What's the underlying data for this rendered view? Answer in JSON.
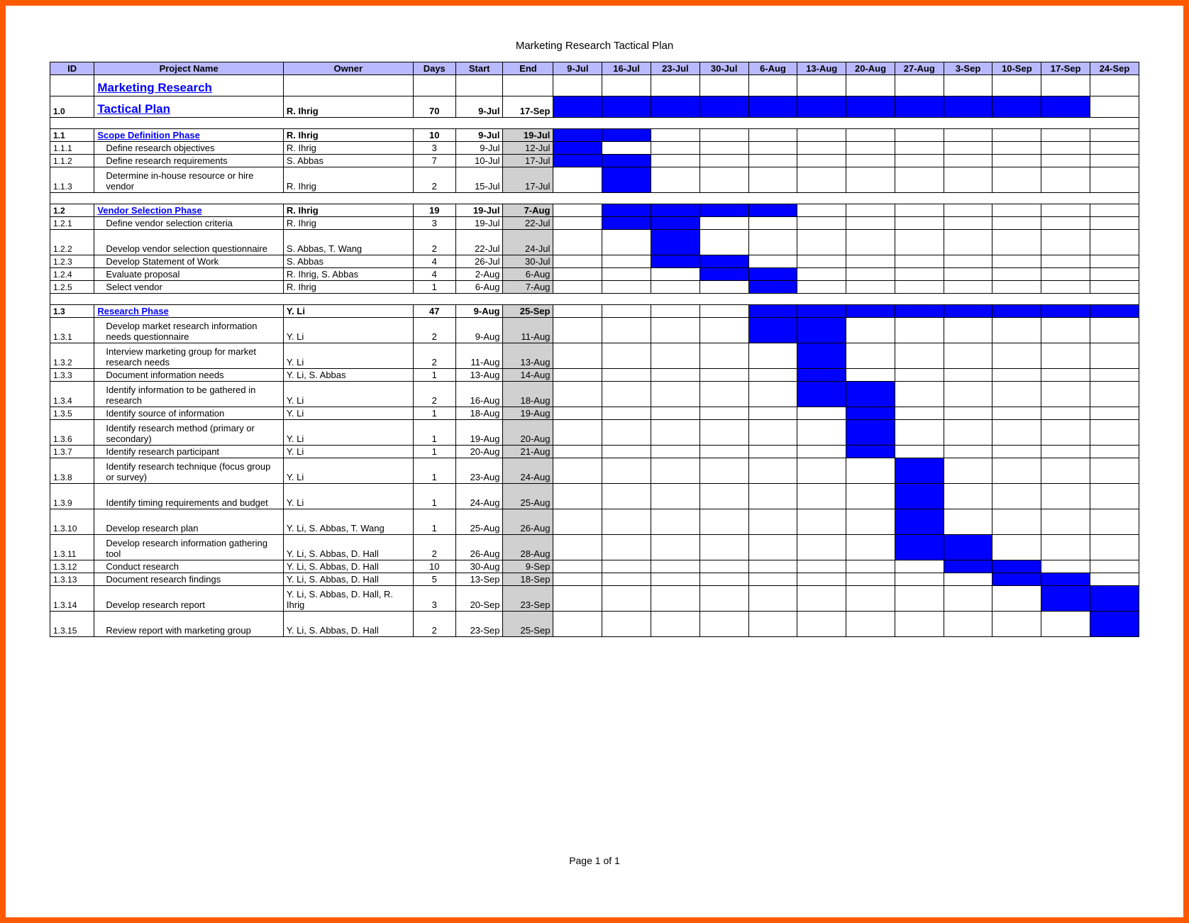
{
  "doc_title": "Marketing Research Tactical Plan",
  "footer": "Page 1 of 1",
  "headers": {
    "id": "ID",
    "name": "Project Name",
    "owner": "Owner",
    "days": "Days",
    "start": "Start",
    "end": "End"
  },
  "weeks": [
    "9-Jul",
    "16-Jul",
    "23-Jul",
    "30-Jul",
    "6-Aug",
    "13-Aug",
    "20-Aug",
    "27-Aug",
    "3-Sep",
    "10-Sep",
    "17-Sep",
    "24-Sep"
  ],
  "rows": [
    {
      "type": "title",
      "id": "",
      "name": "Marketing Research",
      "link": true
    },
    {
      "type": "title",
      "id": "1.0",
      "name": "Tactical Plan",
      "owner": "R. Ihrig",
      "days": "70",
      "start": "9-Jul",
      "end": "17-Sep",
      "link": true,
      "bars": [
        0,
        1,
        2,
        3,
        4,
        5,
        6,
        7,
        8,
        9,
        10
      ],
      "bold": true,
      "shade": false
    },
    {
      "type": "spacer"
    },
    {
      "type": "phase",
      "id": "1.1",
      "name": "Scope Definition Phase",
      "owner": "R. Ihrig",
      "days": "10",
      "start": "9-Jul",
      "end": "19-Jul",
      "link": true,
      "bars": [
        0,
        1
      ],
      "bold": true
    },
    {
      "id": "1.1.1",
      "name": "Define research objectives",
      "owner": "R. Ihrig",
      "days": "3",
      "start": "9-Jul",
      "end": "12-Jul",
      "bars": [
        0
      ],
      "indent": true
    },
    {
      "id": "1.1.2",
      "name": "Define research requirements",
      "owner": "S. Abbas",
      "days": "7",
      "start": "10-Jul",
      "end": "17-Jul",
      "bars": [
        0,
        1
      ],
      "indent": true
    },
    {
      "id": "1.1.3",
      "name": "Determine in-house resource or hire vendor",
      "owner": "R. Ihrig",
      "days": "2",
      "start": "15-Jul",
      "end": "17-Jul",
      "bars": [
        1
      ],
      "indent": true,
      "tall": true
    },
    {
      "type": "spacer"
    },
    {
      "type": "phase",
      "id": "1.2",
      "name": "Vendor Selection Phase",
      "owner": "R. Ihrig",
      "days": "19",
      "start": "19-Jul",
      "end": "7-Aug",
      "link": true,
      "bars": [
        1,
        2,
        3,
        4
      ],
      "bold": true
    },
    {
      "id": "1.2.1",
      "name": "Define vendor selection criteria",
      "owner": "R. Ihrig",
      "days": "3",
      "start": "19-Jul",
      "end": "22-Jul",
      "bars": [
        1,
        2
      ],
      "indent": true
    },
    {
      "id": "1.2.2",
      "name": "Develop vendor selection questionnaire",
      "owner": "S. Abbas, T. Wang",
      "days": "2",
      "start": "22-Jul",
      "end": "24-Jul",
      "bars": [
        2
      ],
      "indent": true,
      "tall": true
    },
    {
      "id": "1.2.3",
      "name": "Develop Statement of Work",
      "owner": "S. Abbas",
      "days": "4",
      "start": "26-Jul",
      "end": "30-Jul",
      "bars": [
        2,
        3
      ],
      "indent": true
    },
    {
      "id": "1.2.4",
      "name": "Evaluate proposal",
      "owner": "R. Ihrig, S. Abbas",
      "days": "4",
      "start": "2-Aug",
      "end": "6-Aug",
      "bars": [
        3,
        4
      ],
      "indent": true
    },
    {
      "id": "1.2.5",
      "name": "Select vendor",
      "owner": "R. Ihrig",
      "days": "1",
      "start": "6-Aug",
      "end": "7-Aug",
      "bars": [
        4
      ],
      "indent": true
    },
    {
      "type": "spacer"
    },
    {
      "type": "phase",
      "id": "1.3",
      "name": "Research Phase",
      "owner": "Y. Li",
      "days": "47",
      "start": "9-Aug",
      "end": "25-Sep",
      "link": true,
      "bars": [
        4,
        5,
        6,
        7,
        8,
        9,
        10,
        11
      ],
      "bold": true
    },
    {
      "id": "1.3.1",
      "name": "Develop market research information needs questionnaire",
      "owner": "Y. Li",
      "days": "2",
      "start": "9-Aug",
      "end": "11-Aug",
      "bars": [
        4,
        5
      ],
      "indent": true,
      "tall": true
    },
    {
      "id": "1.3.2",
      "name": "Interview marketing group for market research needs",
      "owner": "Y. Li",
      "days": "2",
      "start": "11-Aug",
      "end": "13-Aug",
      "bars": [
        5
      ],
      "indent": true,
      "tall": true
    },
    {
      "id": "1.3.3",
      "name": "Document information needs",
      "owner": "Y. Li, S. Abbas",
      "days": "1",
      "start": "13-Aug",
      "end": "14-Aug",
      "bars": [
        5
      ],
      "indent": true
    },
    {
      "id": "1.3.4",
      "name": "Identify information to be gathered in research",
      "owner": "Y. Li",
      "days": "2",
      "start": "16-Aug",
      "end": "18-Aug",
      "bars": [
        5,
        6
      ],
      "indent": true,
      "tall": true
    },
    {
      "id": "1.3.5",
      "name": "Identify source of information",
      "owner": "Y. Li",
      "days": "1",
      "start": "18-Aug",
      "end": "19-Aug",
      "bars": [
        6
      ],
      "indent": true
    },
    {
      "id": "1.3.6",
      "name": "Identify research method (primary or secondary)",
      "owner": "Y. Li",
      "days": "1",
      "start": "19-Aug",
      "end": "20-Aug",
      "bars": [
        6
      ],
      "indent": true,
      "tall": true
    },
    {
      "id": "1.3.7",
      "name": "Identify research participant",
      "owner": "Y. Li",
      "days": "1",
      "start": "20-Aug",
      "end": "21-Aug",
      "bars": [
        6
      ],
      "indent": true
    },
    {
      "id": "1.3.8",
      "name": "Identify research technique (focus group or survey)",
      "owner": "Y. Li",
      "days": "1",
      "start": "23-Aug",
      "end": "24-Aug",
      "bars": [
        7
      ],
      "indent": true,
      "tall": true
    },
    {
      "id": "1.3.9",
      "name": "Identify timing requirements and budget",
      "owner": "Y. Li",
      "days": "1",
      "start": "24-Aug",
      "end": "25-Aug",
      "bars": [
        7
      ],
      "indent": true,
      "tall": true
    },
    {
      "id": "1.3.10",
      "name": "Develop research plan",
      "owner": "Y. Li, S. Abbas, T. Wang",
      "days": "1",
      "start": "25-Aug",
      "end": "26-Aug",
      "bars": [
        7
      ],
      "indent": true,
      "tall": true,
      "spaceAbove": true
    },
    {
      "id": "1.3.11",
      "name": "Develop research information gathering tool",
      "owner": "Y. Li, S. Abbas, D. Hall",
      "days": "2",
      "start": "26-Aug",
      "end": "28-Aug",
      "bars": [
        7,
        8
      ],
      "indent": true,
      "tall": true
    },
    {
      "id": "1.3.12",
      "name": "Conduct research",
      "owner": "Y. Li, S. Abbas, D. Hall",
      "days": "10",
      "start": "30-Aug",
      "end": "9-Sep",
      "bars": [
        8,
        9
      ],
      "indent": true
    },
    {
      "id": "1.3.13",
      "name": "Document research findings",
      "owner": "Y. Li, S. Abbas, D. Hall",
      "days": "5",
      "start": "13-Sep",
      "end": "18-Sep",
      "bars": [
        9,
        10
      ],
      "indent": true
    },
    {
      "id": "1.3.14",
      "name": "Develop research report",
      "owner": "Y. Li, S. Abbas, D. Hall, R. Ihrig",
      "days": "3",
      "start": "20-Sep",
      "end": "23-Sep",
      "bars": [
        10,
        11
      ],
      "indent": true,
      "tall": true
    },
    {
      "id": "1.3.15",
      "name": "Review report with marketing group",
      "owner": "Y. Li, S. Abbas, D. Hall",
      "days": "2",
      "start": "23-Sep",
      "end": "25-Sep",
      "bars": [
        11
      ],
      "indent": true,
      "tall": true
    }
  ]
}
